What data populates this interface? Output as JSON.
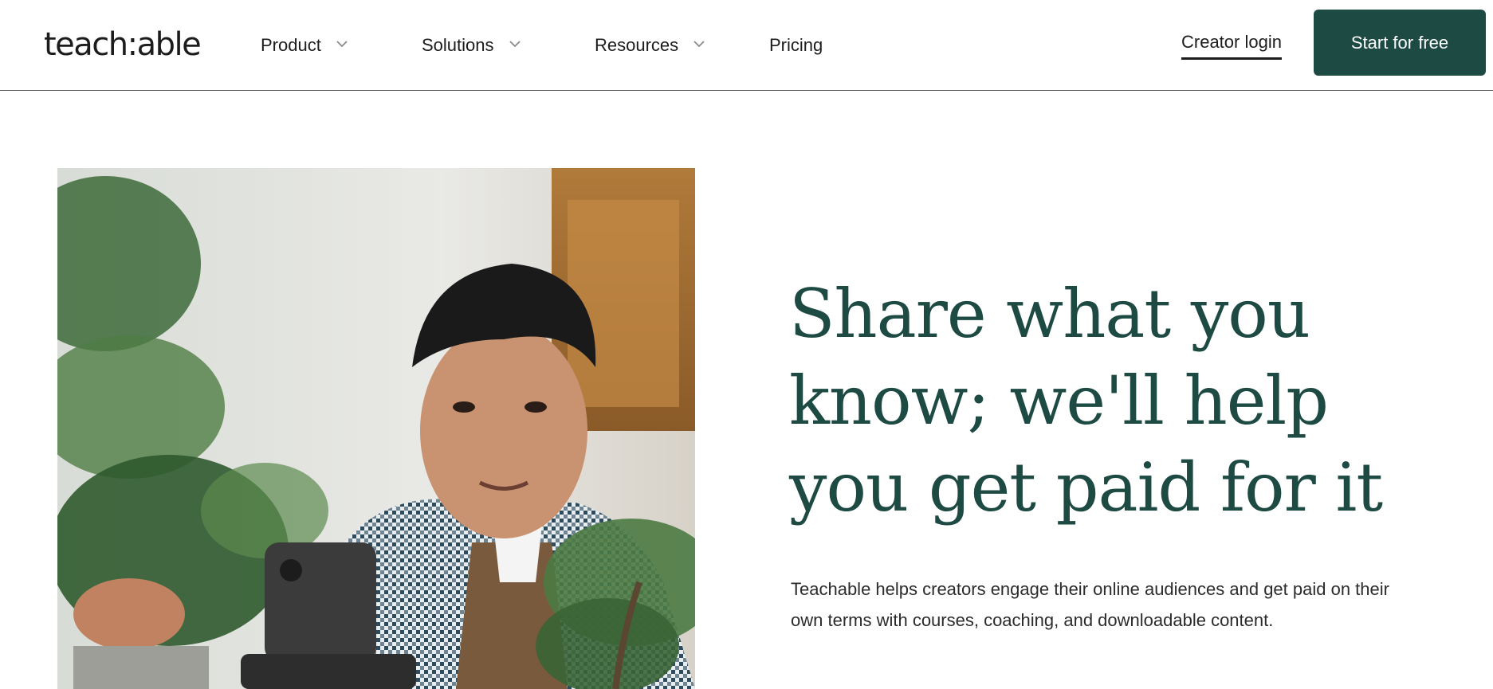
{
  "header": {
    "logo": "teach:able",
    "nav": [
      {
        "label": "Product",
        "has_dropdown": true
      },
      {
        "label": "Solutions",
        "has_dropdown": true
      },
      {
        "label": "Resources",
        "has_dropdown": true
      },
      {
        "label": "Pricing",
        "has_dropdown": false
      }
    ],
    "login_label": "Creator login",
    "cta_label": "Start for free"
  },
  "hero": {
    "title": "Share what you know; we'll help you get paid for it",
    "subtitle": "Teachable helps creators engage their online audiences and get paid on their own terms with courses, coaching, and downloadable content.",
    "image_subject": "creator-filming-plants-photo"
  },
  "colors": {
    "brand": "#1d4a42",
    "text": "#1c1c1c",
    "divider": "#5b5b5b"
  }
}
